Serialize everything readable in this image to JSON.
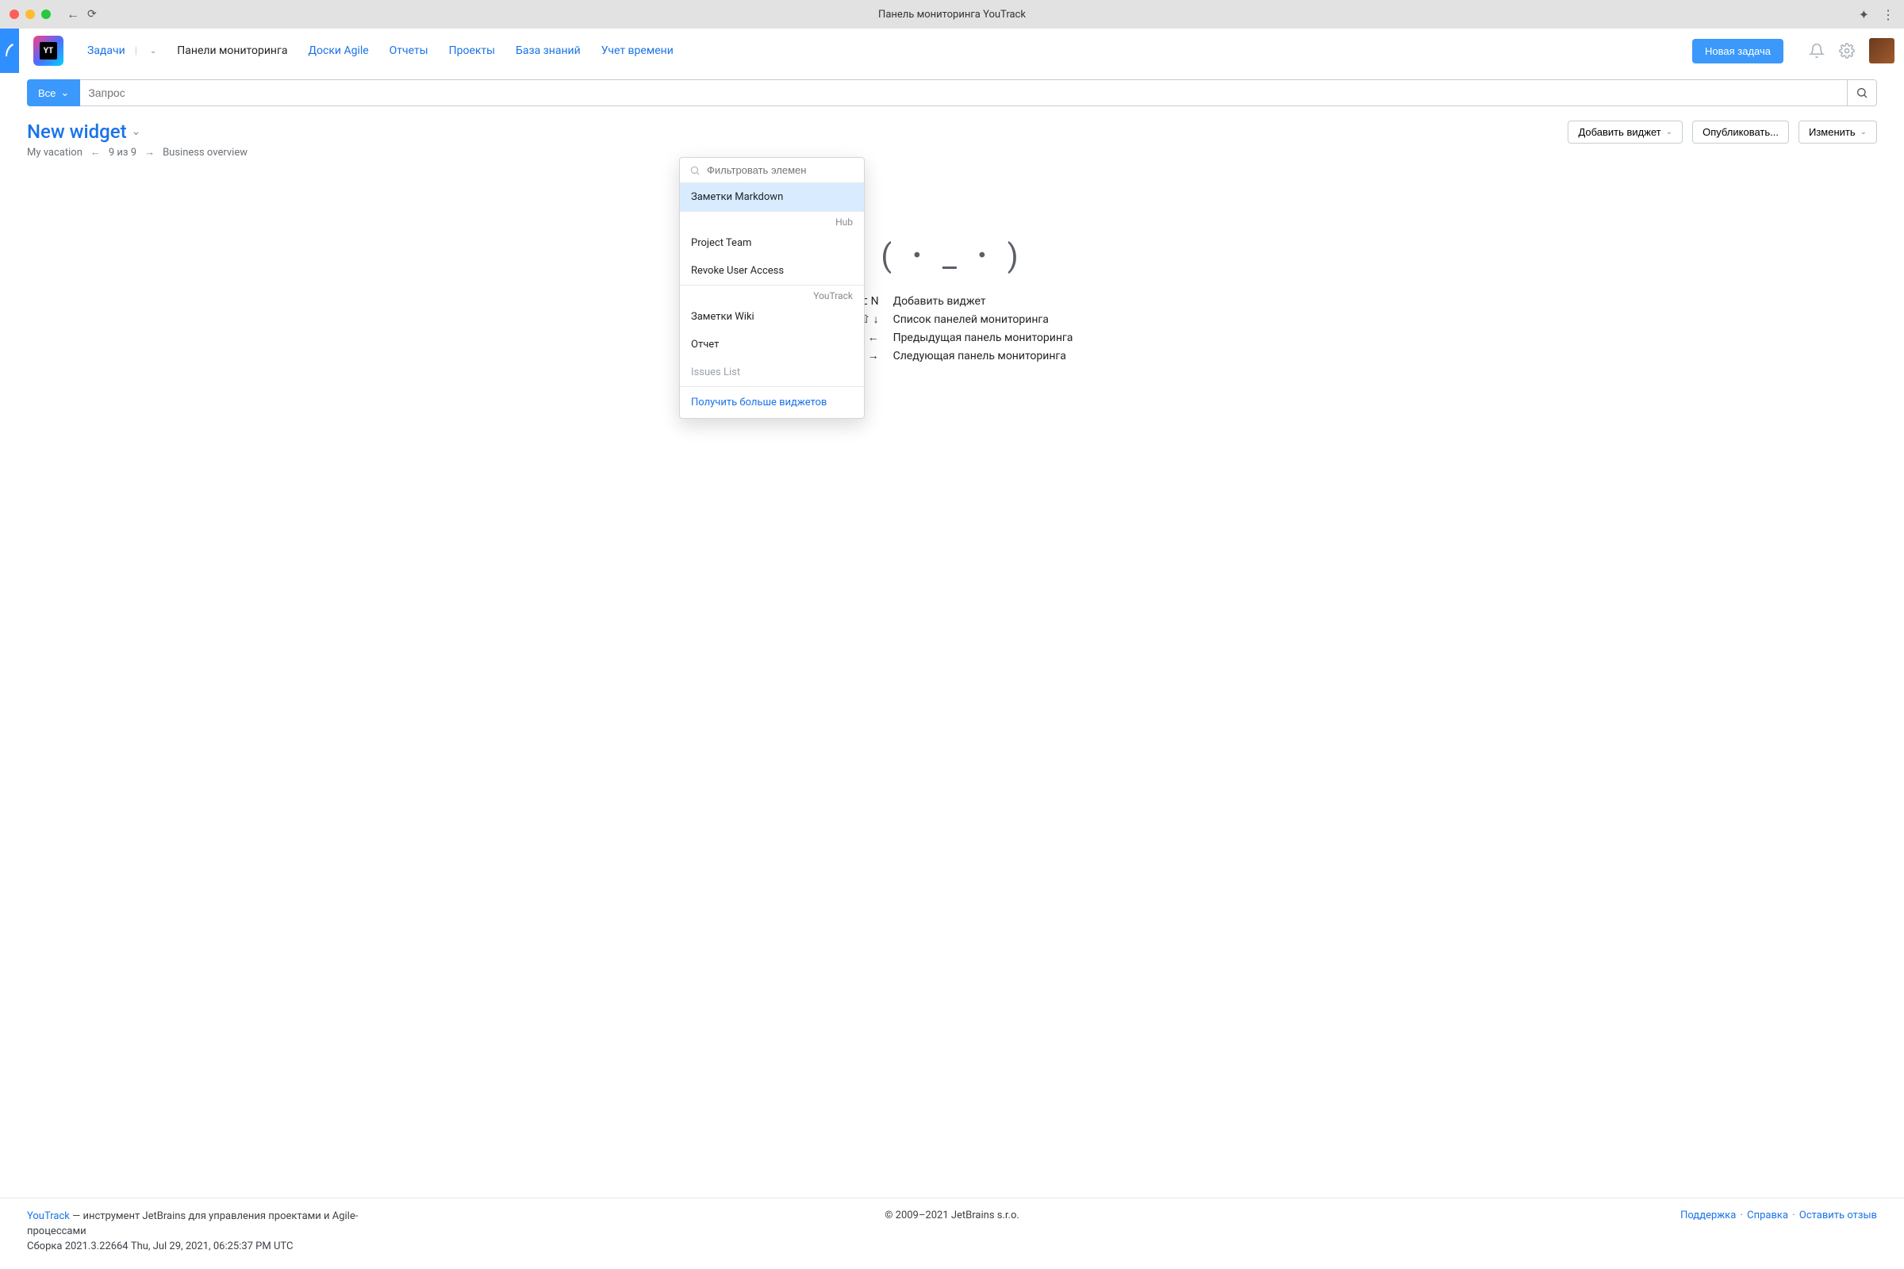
{
  "window": {
    "title": "Панель мониторинга YouTrack"
  },
  "logo": {
    "text": "YT"
  },
  "nav": {
    "issues": "Задачи",
    "dashboards": "Панели мониторинга",
    "agile": "Доски Agile",
    "reports": "Отчеты",
    "projects": "Проекты",
    "kb": "База знаний",
    "timesheets": "Учет времени",
    "new_issue": "Новая задача"
  },
  "search": {
    "scope": "Все",
    "placeholder": "Запрос"
  },
  "page": {
    "title": "New widget",
    "bc_prev": "My vacation",
    "bc_count": "9 из 9",
    "bc_next": "Business overview"
  },
  "actions": {
    "add_widget": "Добавить виджет",
    "publish": "Опубликовать...",
    "edit": "Изменить"
  },
  "empty": {
    "face": "( ･ _ ･ )",
    "k1": "⌃ ⌥ N",
    "t1": "Добавить виджет",
    "k2": "⇧ ↓",
    "t2": "Список панелей мониторинга",
    "k3": "⇧ ←",
    "t3": "Предыдущая панель мониторинга",
    "k4": "⇧ →",
    "t4": "Следующая панель мониторинга"
  },
  "dropdown": {
    "filter_ph": "Фильтровать элемен",
    "markdown": "Заметки Markdown",
    "group_hub": "Hub",
    "project_team": "Project Team",
    "revoke": "Revoke User Access",
    "group_yt": "YouTrack",
    "wiki": "Заметки Wiki",
    "report": "Отчет",
    "issues_list": "Issues List",
    "get_more": "Получить больше виджетов"
  },
  "footer": {
    "brand": "YouTrack",
    "tagline": " — инструмент JetBrains для управления проектами и Agile-процессами",
    "build": "Сборка 2021.3.22664 Thu, Jul 29, 2021, 06:25:37 PM UTC",
    "copyright": "© 2009–2021 JetBrains s.r.o.",
    "support": "Поддержка",
    "help": "Справка",
    "feedback": "Оставить отзыв"
  }
}
